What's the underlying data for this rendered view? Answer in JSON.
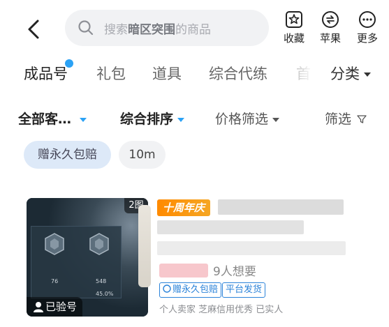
{
  "header": {
    "search_placeholder_prefix": "搜索",
    "search_placeholder_game": "暗区突围",
    "search_placeholder_suffix": "的商品",
    "actions": [
      {
        "label": "收藏",
        "icon": "favorite-star-icon"
      },
      {
        "label": "苹果",
        "icon": "apple-platform-icon"
      },
      {
        "label": "更多",
        "icon": "more-dots-icon"
      }
    ]
  },
  "categories": {
    "items": [
      "成品号",
      "礼包",
      "道具",
      "综合代练",
      "首"
    ],
    "active_index": 0,
    "has_dot_on_first": true,
    "more_label": "分类"
  },
  "filters": {
    "client": "全部客…",
    "sort": "综合排序",
    "price": "价格筛选",
    "filter": "筛选"
  },
  "chips": [
    "赠永久包赔",
    "10m"
  ],
  "listing": {
    "image_count": "2图",
    "verified_label": "已验号",
    "promo_tag": "十周年庆",
    "want_count": "9人想要",
    "tags": [
      "赠永久包赔",
      "平台发货"
    ],
    "seller_info": "个人卖家 芝麻信用优秀 已实人",
    "colors": {
      "accent": "#2ba2f5",
      "promo": "#ff8a00",
      "tag": "#2b83d9"
    }
  }
}
